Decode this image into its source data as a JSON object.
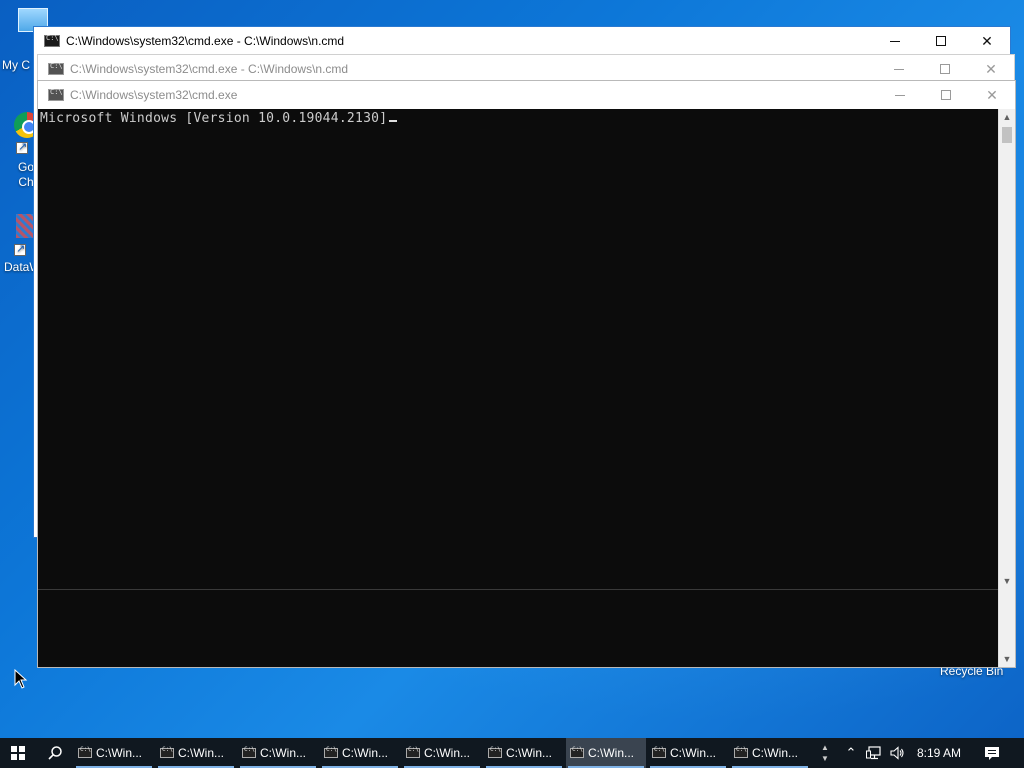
{
  "desktop": {
    "icons": [
      {
        "label": "My C"
      },
      {
        "label": "Go\nCh"
      },
      {
        "label": "DataW"
      },
      {
        "label": "Recycle Bin"
      }
    ]
  },
  "windows": {
    "back1": {
      "title": "C:\\Windows\\system32\\cmd.exe - C:\\Windows\\n.cmd"
    },
    "back2": {
      "title": "C:\\Windows\\system32\\cmd.exe - C:\\Windows\\n.cmd"
    },
    "front": {
      "title": "C:\\Windows\\system32\\cmd.exe",
      "console_line": "Microsoft Windows [Version 10.0.19044.2130]"
    },
    "controls": {
      "minimize": "—",
      "maximize": "☐",
      "close": "✕"
    }
  },
  "taskbar": {
    "buttons": [
      {
        "label": "C:\\Win..."
      },
      {
        "label": "C:\\Win..."
      },
      {
        "label": "C:\\Win..."
      },
      {
        "label": "C:\\Win..."
      },
      {
        "label": "C:\\Win..."
      },
      {
        "label": "C:\\Win..."
      },
      {
        "label": "C:\\Win..."
      },
      {
        "label": "C:\\Win..."
      },
      {
        "label": "C:\\Win..."
      }
    ],
    "active_index": 6,
    "clock": "8:19 AM"
  },
  "colors": {
    "console_bg": "#0c0c0c",
    "console_text": "#cccccc",
    "taskbar_bg": "#101820",
    "desktop_blue": "#0d77d8"
  },
  "icons": [
    "windows-logo-icon",
    "search-icon",
    "cmd-icon",
    "chevron-up-icon",
    "network-icon",
    "volume-icon",
    "notification-icon",
    "minimize-icon",
    "maximize-icon",
    "close-icon"
  ]
}
